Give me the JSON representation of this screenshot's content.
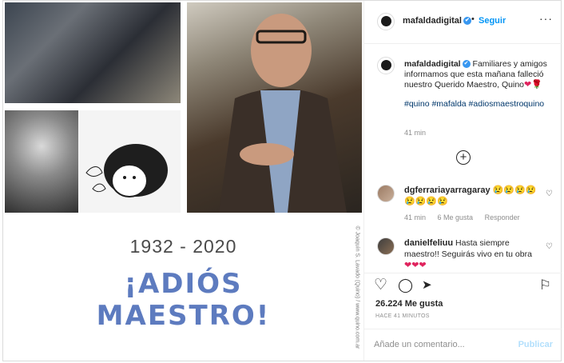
{
  "post": {
    "image": {
      "years": "1932 - 2020",
      "title_line1": "¡ADIÓS",
      "title_line2": "MAESTRO!",
      "credit": "© Joaquín S. Lavado (Quino) / www.quino.com.ar"
    }
  },
  "header": {
    "username": "mafaldadigital",
    "verified_icon": "✔",
    "separator": "•",
    "follow_label": "Seguir",
    "more_label": "···"
  },
  "caption": {
    "username": "mafaldadigital",
    "verified_icon": "✔",
    "text": "Familiares y amigos informamos que esta mañana falleció nuestro Querido Maestro, Quino",
    "emojis": "❤🌹",
    "hashtags": "#quino #mafalda #adiosmaestroquino",
    "time": "41 min"
  },
  "load_more_label": "+",
  "comments": [
    {
      "username": "dgferrariayarragaray",
      "text": "😢😢😢😢😢😢😢😢",
      "time": "41 min",
      "likes": "6 Me gusta",
      "reply": "Responder",
      "like_icon": "♡"
    },
    {
      "username": "danielfeliuu",
      "text": "Hasta siempre maestro!! Seguirás vivo en tu obra",
      "hearts": "❤❤❤",
      "like_icon": "♡"
    }
  ],
  "actions": {
    "like_icon": "♡",
    "comment_icon": "◯",
    "share_icon": "➤",
    "save_icon": "⚐",
    "likes_count": "26.224 Me gusta",
    "posted": "HACE 41 MINUTOS"
  },
  "comment_input": {
    "placeholder": "Añade un comentario...",
    "publish_label": "Publicar"
  },
  "colors": {
    "accent_blue": "#0095f6",
    "title_blue": "#5d7bbf",
    "heart_red": "#e0245e"
  }
}
